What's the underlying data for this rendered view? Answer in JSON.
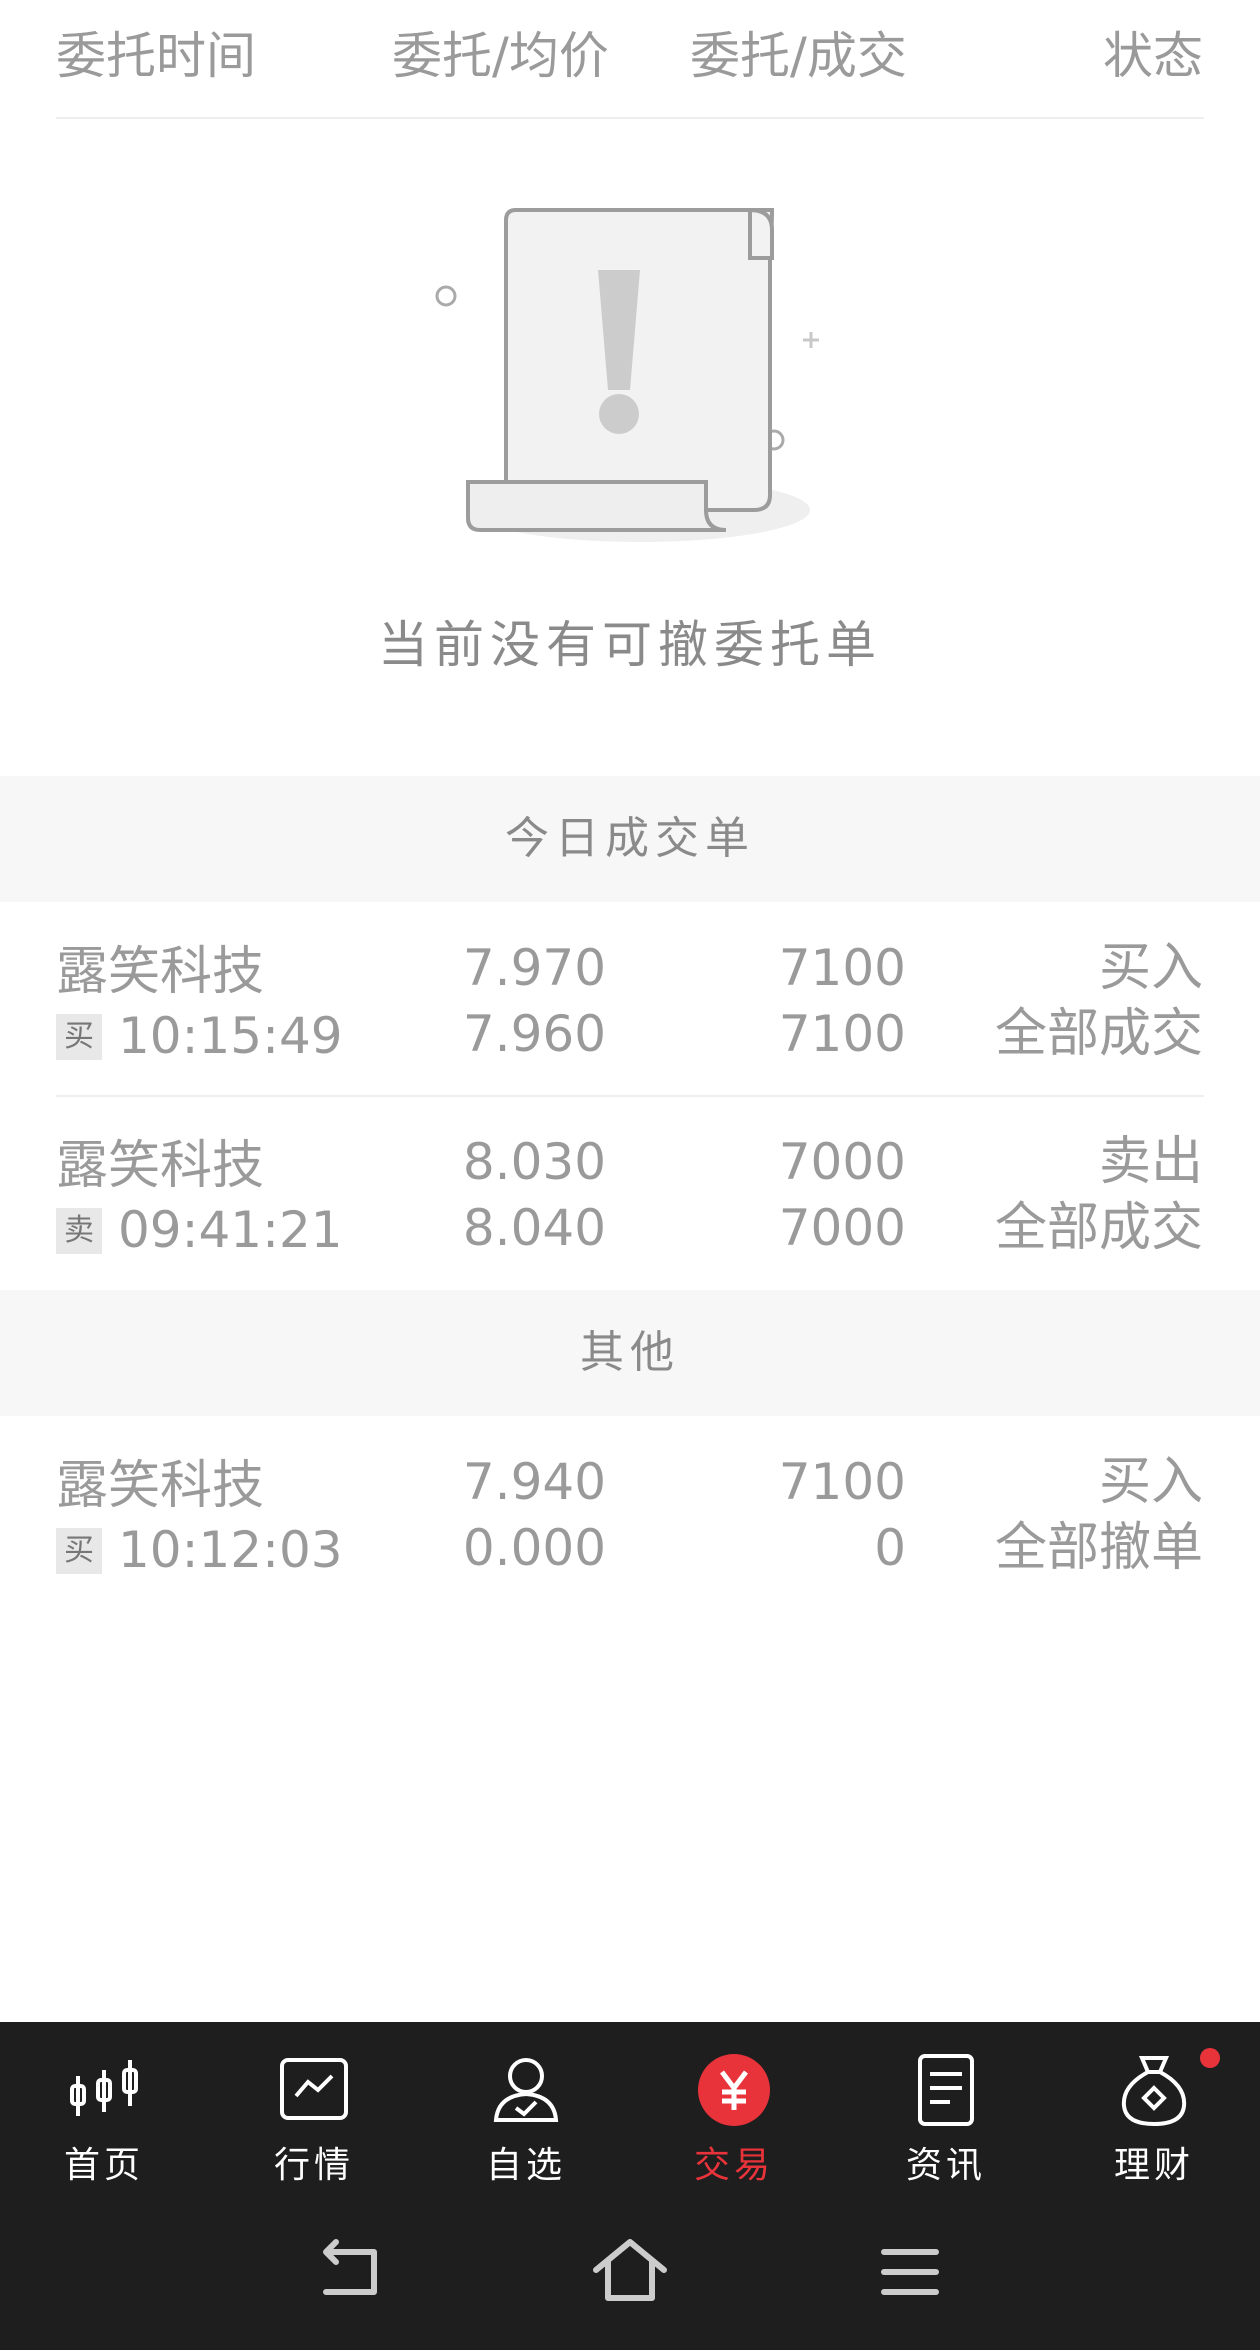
{
  "header": {
    "col1": "委托时间",
    "col2": "委托/均价",
    "col3": "委托/成交",
    "col4": "状态"
  },
  "empty_state": {
    "message": "当前没有可撤委托单"
  },
  "sections": {
    "today_label": "今日成交单",
    "other_label": "其他"
  },
  "today_rows": [
    {
      "name": "露笑科技",
      "side_badge": "买",
      "time": "10:15:49",
      "price_order": "7.970",
      "price_avg": "7.960",
      "qty_order": "7100",
      "qty_done": "7100",
      "direction": "买入",
      "status": "全部成交"
    },
    {
      "name": "露笑科技",
      "side_badge": "卖",
      "time": "09:41:21",
      "price_order": "8.030",
      "price_avg": "8.040",
      "qty_order": "7000",
      "qty_done": "7000",
      "direction": "卖出",
      "status": "全部成交"
    }
  ],
  "other_rows": [
    {
      "name": "露笑科技",
      "side_badge": "买",
      "time": "10:12:03",
      "price_order": "7.940",
      "price_avg": "0.000",
      "qty_order": "7100",
      "qty_done": "0",
      "direction": "买入",
      "status": "全部撤单"
    }
  ],
  "tabbar": {
    "items": [
      {
        "label": "首页",
        "icon": "candlestick-icon"
      },
      {
        "label": "行情",
        "icon": "chart-icon"
      },
      {
        "label": "自选",
        "icon": "person-check-icon"
      },
      {
        "label": "交易",
        "icon": "yuan-icon",
        "active": true
      },
      {
        "label": "资讯",
        "icon": "document-icon"
      },
      {
        "label": "理财",
        "icon": "money-bag-icon",
        "badge": true
      }
    ],
    "active_color": "#e8333b"
  },
  "colors": {
    "text_gray": "#9a9a9a",
    "section_bg": "#f7f7f7",
    "tabbar_bg": "#1e1e1e",
    "accent": "#e8333b"
  }
}
